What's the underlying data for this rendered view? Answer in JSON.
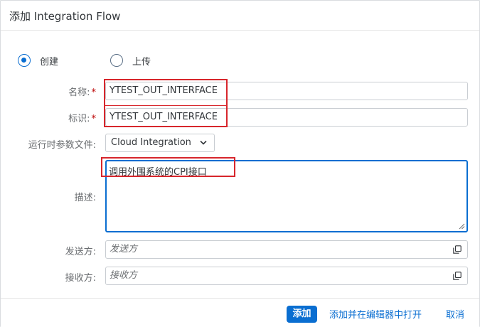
{
  "dialog": {
    "title": "添加 Integration Flow"
  },
  "mode": {
    "options": [
      {
        "label": "创建",
        "checked": true
      },
      {
        "label": "上传",
        "checked": false
      }
    ]
  },
  "form": {
    "name": {
      "label": "名称:",
      "required_mark": "*",
      "value": "YTEST_OUT_INTERFACE"
    },
    "id": {
      "label": "标识:",
      "required_mark": "*",
      "value": "YTEST_OUT_INTERFACE"
    },
    "runtime_profile": {
      "label": "运行时参数文件:",
      "value": "Cloud Integration"
    },
    "description": {
      "label": "描述:",
      "value": "调用外围系统的CPI接口"
    },
    "sender": {
      "label": "发送方:",
      "placeholder": "发送方"
    },
    "receiver": {
      "label": "接收方:",
      "placeholder": "接收方"
    }
  },
  "footer": {
    "add_label": "添加",
    "add_and_open_label": "添加并在编辑器中打开",
    "cancel_label": "取消"
  },
  "colors": {
    "accent": "#0a6ed1",
    "required": "#bb0000",
    "annotation_box": "#d7262c"
  },
  "icons": {
    "value_help": "value-help-icon",
    "dropdown": "chevron-down-icon",
    "resize": "resize-grip-icon"
  }
}
